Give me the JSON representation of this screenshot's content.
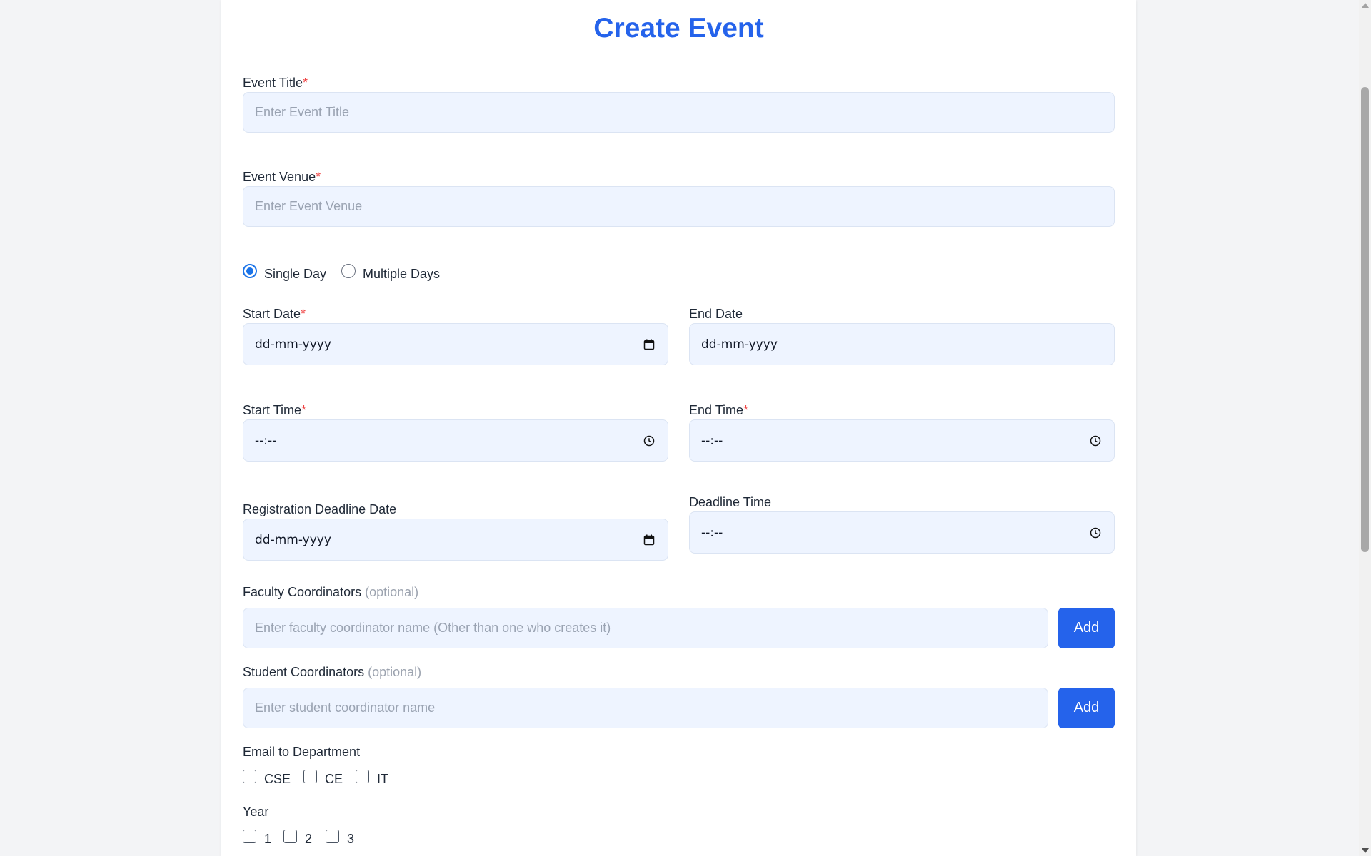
{
  "form": {
    "title": "Create Event",
    "required_mark": "*",
    "event_title": {
      "label": "Event Title",
      "placeholder": "Enter Event Title"
    },
    "event_venue": {
      "label": "Event Venue",
      "placeholder": "Enter Event Venue"
    },
    "day_mode": {
      "options": [
        "Single Day",
        "Multiple Days"
      ],
      "selected": "Single Day"
    },
    "start_date": {
      "label": "Start Date",
      "value": "dd-mm-yyyy"
    },
    "end_date": {
      "label": "End Date",
      "value": "dd-mm-yyyy"
    },
    "start_time": {
      "label": "Start Time",
      "value": "--:--"
    },
    "end_time": {
      "label": "End Time",
      "value": "--:--"
    },
    "deadline_date": {
      "label": "Registration Deadline Date",
      "value": "dd-mm-yyyy"
    },
    "deadline_time": {
      "label": "Deadline Time",
      "value": "--:--"
    },
    "faculty": {
      "label": "Faculty Coordinators",
      "optional": "(optional)",
      "placeholder": "Enter faculty coordinator name (Other than one who creates it)",
      "button": "Add"
    },
    "student": {
      "label": "Student Coordinators",
      "optional": "(optional)",
      "placeholder": "Enter student coordinator name",
      "button": "Add"
    },
    "email_department": {
      "label": "Email to Department",
      "options": [
        "CSE",
        "CE",
        "IT"
      ]
    },
    "year": {
      "label": "Year",
      "options": [
        "1",
        "2",
        "3"
      ]
    }
  },
  "icons": {
    "date": "calendar-icon",
    "time": "clock-icon"
  },
  "colors": {
    "accent": "#2563eb",
    "required": "#ef4444",
    "input_bg": "#eef4ff",
    "page_bg": "#f3f4f6"
  }
}
